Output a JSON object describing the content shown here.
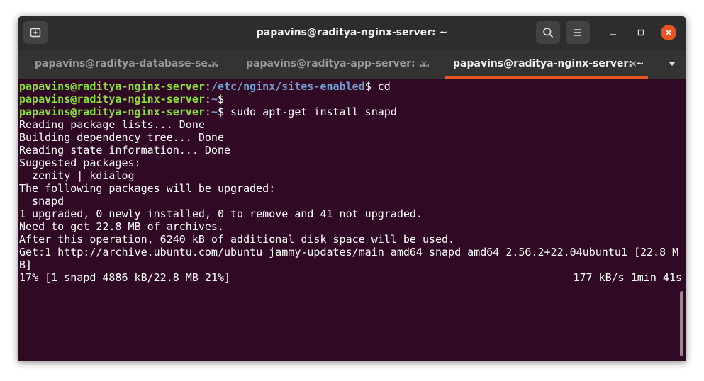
{
  "window": {
    "title": "papavins@raditya-nginx-server: ~"
  },
  "tabs": [
    {
      "label": "papavins@raditya-database-se...",
      "active": false
    },
    {
      "label": "papavins@raditya-app-server: ...",
      "active": false
    },
    {
      "label": "papavins@raditya-nginx-server: ~",
      "active": true
    }
  ],
  "icons": {
    "new_tab": "new-tab-icon",
    "search": "search-icon",
    "menu": "hamburger-menu-icon",
    "minimize": "minimize-icon",
    "maximize": "maximize-icon",
    "close": "close-icon",
    "tab_close": "tab-close-icon",
    "tab_list": "chevron-down-icon"
  },
  "colors": {
    "terminal_bg": "#300a24",
    "prompt_user": "#8ae234",
    "prompt_path": "#729fcf",
    "text": "#ffffff",
    "accent": "#e95420"
  },
  "terminal": {
    "prompts": [
      {
        "user": "papavins@raditya-nginx-server",
        "sep": ":",
        "path": "/etc/nginx/sites-enabled",
        "symbol": "$ ",
        "command": "cd"
      },
      {
        "user": "papavins@raditya-nginx-server",
        "sep": ":",
        "path": "~",
        "symbol": "$",
        "command": ""
      },
      {
        "user": "papavins@raditya-nginx-server",
        "sep": ":",
        "path": "~",
        "symbol": "$ ",
        "command": "sudo apt-get install snapd"
      }
    ],
    "output": [
      "Reading package lists... Done",
      "Building dependency tree... Done",
      "Reading state information... Done",
      "Suggested packages:",
      "  zenity | kdialog",
      "The following packages will be upgraded:",
      "  snapd",
      "1 upgraded, 0 newly installed, 0 to remove and 41 not upgraded.",
      "Need to get 22.8 MB of archives.",
      "After this operation, 6240 kB of additional disk space will be used.",
      "Get:1 http://archive.ubuntu.com/ubuntu jammy-updates/main amd64 snapd amd64 2.56.2+22.04ubuntu1 [22.8 M",
      "B]"
    ],
    "progress": {
      "left": "17% [1 snapd 4886 kB/22.8 MB 21%]",
      "right": "177 kB/s 1min 41s"
    }
  }
}
